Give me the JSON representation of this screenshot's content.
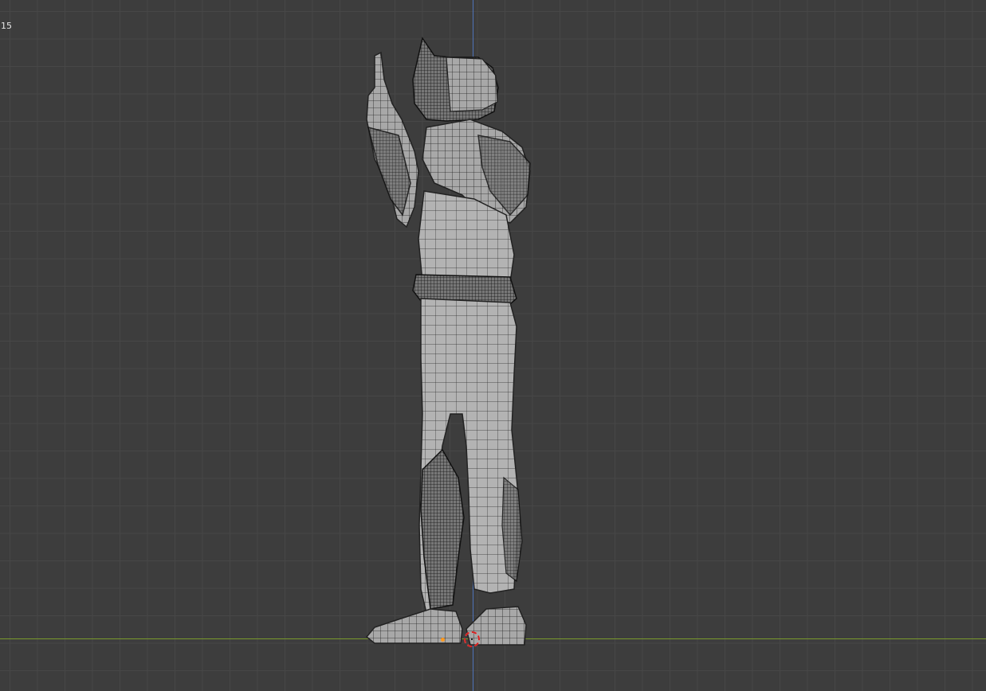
{
  "viewport": {
    "frame_label": "15",
    "mode": "wireframe-overlay",
    "background_color": "#3d3d3d",
    "grid_color": "#474747",
    "axis_colors": {
      "z": "#4f73b8",
      "y": "#7a9a2c"
    },
    "model_icon": "character-mesh-icon",
    "origin_icon": "origin-point-icon",
    "cursor_icon": "3d-cursor-icon"
  }
}
